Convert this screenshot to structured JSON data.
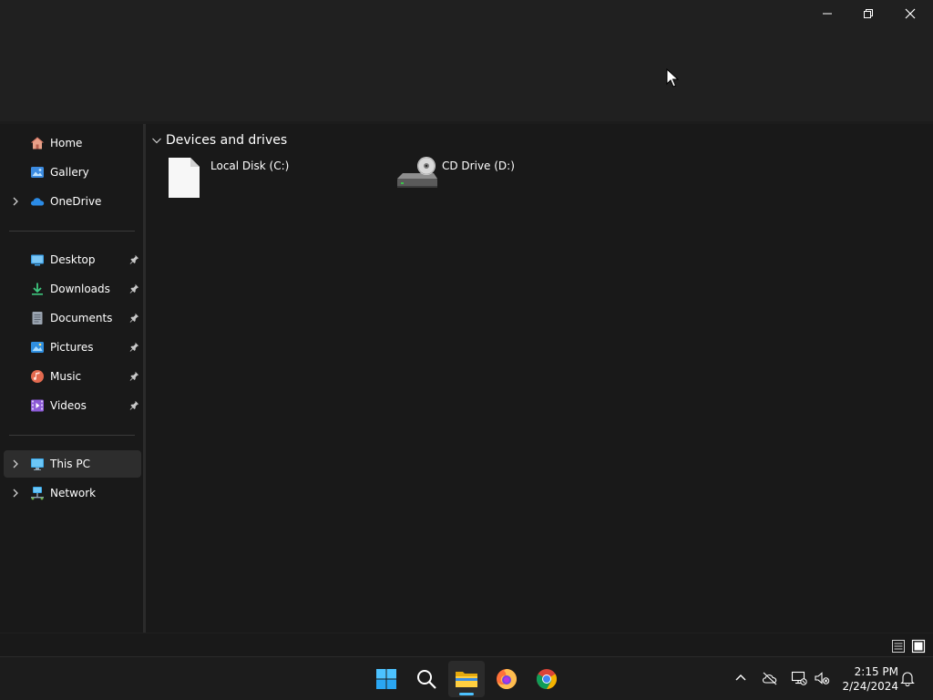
{
  "window": {
    "controls": {
      "minimize": "minimize-icon",
      "maximize": "restore-icon",
      "close": "close-icon"
    }
  },
  "sidebar": {
    "top_items": [
      {
        "label": "Home",
        "icon": "home-icon",
        "expandable": false
      },
      {
        "label": "Gallery",
        "icon": "gallery-icon",
        "expandable": false
      },
      {
        "label": "OneDrive",
        "icon": "onedrive-cloud-icon",
        "expandable": true
      }
    ],
    "quick_access": [
      {
        "label": "Desktop",
        "icon": "desktop-folder-icon",
        "pinned": true
      },
      {
        "label": "Downloads",
        "icon": "downloads-folder-icon",
        "pinned": true
      },
      {
        "label": "Documents",
        "icon": "documents-folder-icon",
        "pinned": true
      },
      {
        "label": "Pictures",
        "icon": "pictures-folder-icon",
        "pinned": true
      },
      {
        "label": "Music",
        "icon": "music-folder-icon",
        "pinned": true
      },
      {
        "label": "Videos",
        "icon": "videos-folder-icon",
        "pinned": true
      }
    ],
    "locations": [
      {
        "label": "This PC",
        "icon": "this-pc-icon",
        "expandable": true,
        "selected": true
      },
      {
        "label": "Network",
        "icon": "network-icon",
        "expandable": true,
        "selected": false
      }
    ]
  },
  "content": {
    "group_title": "Devices and drives",
    "drives": [
      {
        "label": "Local Disk (C:)",
        "icon": "blank-file-icon"
      },
      {
        "label": "CD Drive (D:)",
        "icon": "cd-drive-icon"
      }
    ]
  },
  "statusbar": {
    "views": [
      {
        "name": "details-view",
        "icon": "details-view-icon"
      },
      {
        "name": "large-icons-view",
        "icon": "large-icons-view-icon"
      }
    ]
  },
  "taskbar": {
    "apps": [
      {
        "name": "start",
        "icon": "windows-start-icon",
        "active": false
      },
      {
        "name": "search",
        "icon": "search-icon",
        "active": false
      },
      {
        "name": "file-explorer",
        "icon": "file-explorer-icon",
        "active": true
      },
      {
        "name": "firefox",
        "icon": "firefox-icon",
        "active": false
      },
      {
        "name": "chrome",
        "icon": "chrome-icon",
        "active": false
      }
    ],
    "tray_icons": [
      "chevron-up-icon",
      "onedrive-offline-icon",
      "network-disconnected-icon",
      "volume-muted-icon"
    ],
    "time": "2:15 PM",
    "date": "2/24/2024",
    "notification_icon": "bell-icon"
  },
  "colors": {
    "accent": "#4cc2ff",
    "background": "#191919",
    "titlebar": "#202020",
    "selected": "#2d2d2d"
  }
}
